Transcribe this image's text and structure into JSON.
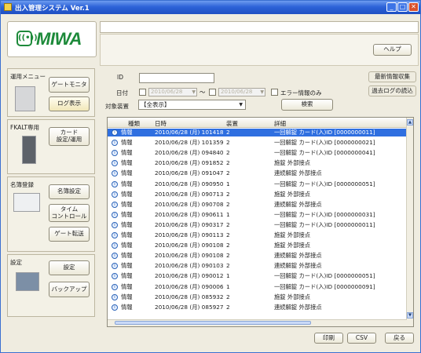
{
  "window": {
    "title": "出入管理システム Ver.1",
    "controls": {
      "minimize": "_",
      "maximize": "□",
      "close": "✕"
    }
  },
  "logo": {
    "text": "MIWA",
    "mark": "((•))"
  },
  "toolbar": {
    "help_label": "ヘルプ"
  },
  "side_panels": {
    "operation_menu": {
      "title": "運用メニュー",
      "gate_monitor": "ゲートモニタ",
      "log_view": "ログ表示"
    },
    "fkalt": {
      "title": "FKALT専用",
      "card_setting": "カード\n設定/運用"
    },
    "registration": {
      "title": "名簿登録",
      "roster_setting": "名簿設定",
      "time_control": "タイム\nコントロール",
      "gate_transfer": "ゲート転送"
    },
    "settings": {
      "title": "設定",
      "setting": "設定",
      "backup": "バックアップ"
    }
  },
  "filter": {
    "id_label": "ID",
    "id_value": "",
    "date_label": "日付",
    "date_from": "2010/06/28",
    "date_to": "2010/06/28",
    "range_sep": "～",
    "device_label": "対象装置",
    "device_value": "【全表示】",
    "error_only_label": "エラー情報のみ",
    "search_label": "検索",
    "latest_label": "最新情報収集",
    "old_log_label": "過去ログの読込"
  },
  "table": {
    "columns": [
      "種類",
      "日時",
      "装置",
      "詳細"
    ],
    "rows": [
      {
        "type": "情報",
        "datetime": "2010/06/28 (月) 101418",
        "device": "2",
        "detail": "一回解錠 カード(入)ID [0000000011]",
        "selected": true
      },
      {
        "type": "情報",
        "datetime": "2010/06/28 (月) 101359",
        "device": "2",
        "detail": "一回解錠 カード(入)ID [0000000021]"
      },
      {
        "type": "情報",
        "datetime": "2010/06/28 (月) 094840",
        "device": "2",
        "detail": "一回解錠 カード(入)ID [0000000041]"
      },
      {
        "type": "情報",
        "datetime": "2010/06/28 (月) 091852",
        "device": "2",
        "detail": "施錠 外部接点"
      },
      {
        "type": "情報",
        "datetime": "2010/06/28 (月) 091047",
        "device": "2",
        "detail": "連続解錠 外部接点"
      },
      {
        "type": "情報",
        "datetime": "2010/06/28 (月) 090950",
        "device": "1",
        "detail": "一回解錠 カード(入)ID [0000000051]"
      },
      {
        "type": "情報",
        "datetime": "2010/06/28 (月) 090713",
        "device": "2",
        "detail": "施錠 外部接点"
      },
      {
        "type": "情報",
        "datetime": "2010/06/28 (月) 090708",
        "device": "2",
        "detail": "連続解錠 外部接点"
      },
      {
        "type": "情報",
        "datetime": "2010/06/28 (月) 090611",
        "device": "1",
        "detail": "一回解錠 カード(入)ID [0000000031]"
      },
      {
        "type": "情報",
        "datetime": "2010/06/28 (月) 090317",
        "device": "2",
        "detail": "一回解錠 カード(入)ID [0000000011]"
      },
      {
        "type": "情報",
        "datetime": "2010/06/28 (月) 090113",
        "device": "2",
        "detail": "施錠 外部接点"
      },
      {
        "type": "情報",
        "datetime": "2010/06/28 (月) 090108",
        "device": "2",
        "detail": "施錠 外部接点"
      },
      {
        "type": "情報",
        "datetime": "2010/06/28 (月) 090108",
        "device": "2",
        "detail": "連続解錠 外部接点"
      },
      {
        "type": "情報",
        "datetime": "2010/06/28 (月) 090103",
        "device": "2",
        "detail": "連続解錠 外部接点"
      },
      {
        "type": "情報",
        "datetime": "2010/06/28 (月) 090012",
        "device": "1",
        "detail": "一回解錠 カード(入)ID [0000000051]"
      },
      {
        "type": "情報",
        "datetime": "2010/06/28 (月) 090006",
        "device": "1",
        "detail": "一回解錠 カード(入)ID [0000000091]"
      },
      {
        "type": "情報",
        "datetime": "2010/06/28 (月) 085932",
        "device": "2",
        "detail": "施錠 外部接点"
      },
      {
        "type": "情報",
        "datetime": "2010/06/28 (月) 085927",
        "device": "2",
        "detail": "連続解錠 外部接点"
      }
    ]
  },
  "footer": {
    "print_label": "印刷",
    "csv_label": "CSV",
    "back_label": "戻る"
  },
  "colors": {
    "titlebar": "#2d63d8",
    "selection": "#2f6fe0",
    "logo_green": "#1d8a3a"
  }
}
